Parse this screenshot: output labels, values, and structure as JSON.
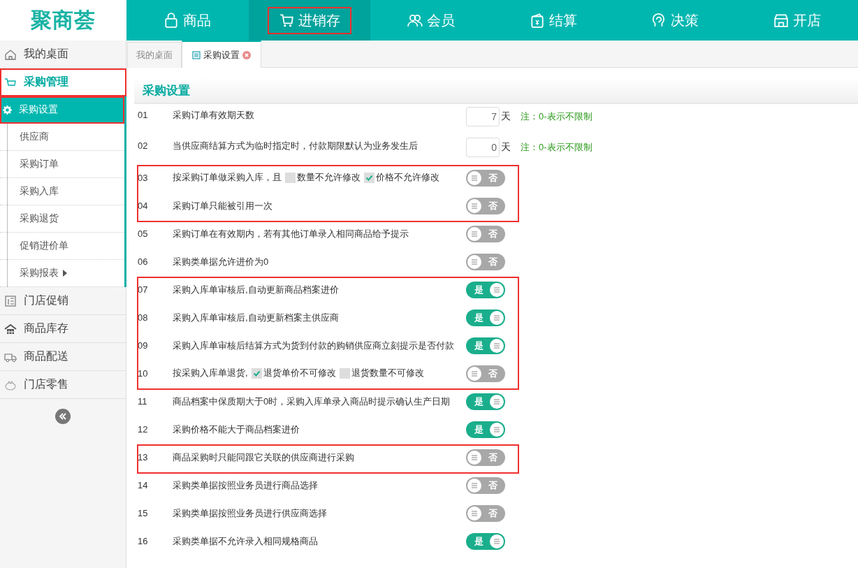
{
  "logo": "聚商荟",
  "nav": [
    {
      "label": "商品",
      "selected": false,
      "highlighted": false
    },
    {
      "label": "进销存",
      "selected": true,
      "highlighted": true
    },
    {
      "label": "会员",
      "selected": false,
      "highlighted": false
    },
    {
      "label": "结算",
      "selected": false,
      "highlighted": false
    },
    {
      "label": "决策",
      "selected": false,
      "highlighted": false
    },
    {
      "label": "开店",
      "selected": false,
      "highlighted": false
    }
  ],
  "sidebar": {
    "items": [
      {
        "label": "我的桌面",
        "expanded": false,
        "highlighted": false
      },
      {
        "label": "采购管理",
        "expanded": true,
        "highlighted": true,
        "children": [
          {
            "label": "采购设置",
            "selected": true,
            "highlighted": true,
            "has_submenu": false
          },
          {
            "label": "供应商",
            "selected": false,
            "highlighted": false,
            "has_submenu": false
          },
          {
            "label": "采购订单",
            "selected": false,
            "highlighted": false,
            "has_submenu": false
          },
          {
            "label": "采购入库",
            "selected": false,
            "highlighted": false,
            "has_submenu": false
          },
          {
            "label": "采购退货",
            "selected": false,
            "highlighted": false,
            "has_submenu": false
          },
          {
            "label": "促销进价单",
            "selected": false,
            "highlighted": false,
            "has_submenu": false
          },
          {
            "label": "采购报表",
            "selected": false,
            "highlighted": false,
            "has_submenu": true
          }
        ]
      },
      {
        "label": "门店促销",
        "expanded": false,
        "highlighted": false
      },
      {
        "label": "商品库存",
        "expanded": false,
        "highlighted": false
      },
      {
        "label": "商品配送",
        "expanded": false,
        "highlighted": false
      },
      {
        "label": "门店零售",
        "expanded": false,
        "highlighted": false
      }
    ]
  },
  "tabs": [
    {
      "label": "我的桌面",
      "selected": false,
      "closable": false
    },
    {
      "label": "采购设置",
      "selected": true,
      "closable": true
    }
  ],
  "panel": {
    "title": "采购设置",
    "groups": [
      {
        "highlighted": false,
        "items": [
          {
            "kind": "number",
            "no": "01",
            "text": "采购订单有效期天数",
            "value": "7",
            "unit": "天",
            "note": "注：0-表示不限制"
          },
          {
            "kind": "number",
            "no": "02",
            "text": "当供应商结算方式为临时指定时，付款期限默认为业务发生后",
            "value": "0",
            "unit": "天",
            "note": "注：0-表示不限制"
          }
        ]
      },
      {
        "highlighted": true,
        "items": [
          {
            "kind": "toggle",
            "no": "03",
            "parts": [
              {
                "kind": "text",
                "text": "按采购订单做采购入库，且"
              },
              {
                "kind": "checkbox",
                "label": "数量不允许修改",
                "checked": false
              },
              {
                "kind": "checkbox",
                "label": "价格不允许修改",
                "checked": true
              }
            ],
            "on": false,
            "toggle_label": "否"
          },
          {
            "kind": "toggle",
            "no": "04",
            "text": "采购订单只能被引用一次",
            "on": false,
            "toggle_label": "否"
          }
        ]
      },
      {
        "highlighted": false,
        "items": [
          {
            "kind": "toggle",
            "no": "05",
            "text": "采购订单在有效期内，若有其他订单录入相同商品给予提示",
            "on": false,
            "toggle_label": "否"
          },
          {
            "kind": "toggle",
            "no": "06",
            "text": "采购类单据允许进价为0",
            "on": false,
            "toggle_label": "否"
          }
        ]
      },
      {
        "highlighted": true,
        "items": [
          {
            "kind": "toggle",
            "no": "07",
            "text": "采购入库单审核后,自动更新商品档案进价",
            "on": true,
            "toggle_label": "是"
          },
          {
            "kind": "toggle",
            "no": "08",
            "text": "采购入库单审核后,自动更新档案主供应商",
            "on": true,
            "toggle_label": "是"
          },
          {
            "kind": "toggle",
            "no": "09",
            "text": "采购入库单审核后结算方式为货到付款的购销供应商立刻提示是否付款",
            "on": true,
            "toggle_label": "是"
          },
          {
            "kind": "toggle",
            "no": "10",
            "parts": [
              {
                "kind": "text",
                "text": "按采购入库单退货,"
              },
              {
                "kind": "checkbox",
                "label": "退货单价不可修改",
                "checked": true
              },
              {
                "kind": "checkbox",
                "label": "退货数量不可修改",
                "checked": false
              }
            ],
            "on": false,
            "toggle_label": "否"
          }
        ]
      },
      {
        "highlighted": false,
        "items": [
          {
            "kind": "toggle",
            "no": "11",
            "text": "商品档案中保质期大于0时，采购入库单录入商品时提示确认生产日期",
            "on": true,
            "toggle_label": "是"
          },
          {
            "kind": "toggle",
            "no": "12",
            "text": "采购价格不能大于商品档案进价",
            "on": true,
            "toggle_label": "是"
          }
        ]
      },
      {
        "highlighted": true,
        "items": [
          {
            "kind": "toggle",
            "no": "13",
            "text": "商品采购时只能同跟它关联的供应商进行采购",
            "on": false,
            "toggle_label": "否"
          }
        ]
      },
      {
        "highlighted": false,
        "items": [
          {
            "kind": "toggle",
            "no": "14",
            "text": "采购类单据按照业务员进行商品选择",
            "on": false,
            "toggle_label": "否"
          },
          {
            "kind": "toggle",
            "no": "15",
            "text": "采购类单据按照业务员进行供应商选择",
            "on": false,
            "toggle_label": "否"
          },
          {
            "kind": "toggle",
            "no": "16",
            "text": "采购类单据不允许录入相同规格商品",
            "on": true,
            "toggle_label": "是"
          }
        ]
      }
    ]
  }
}
